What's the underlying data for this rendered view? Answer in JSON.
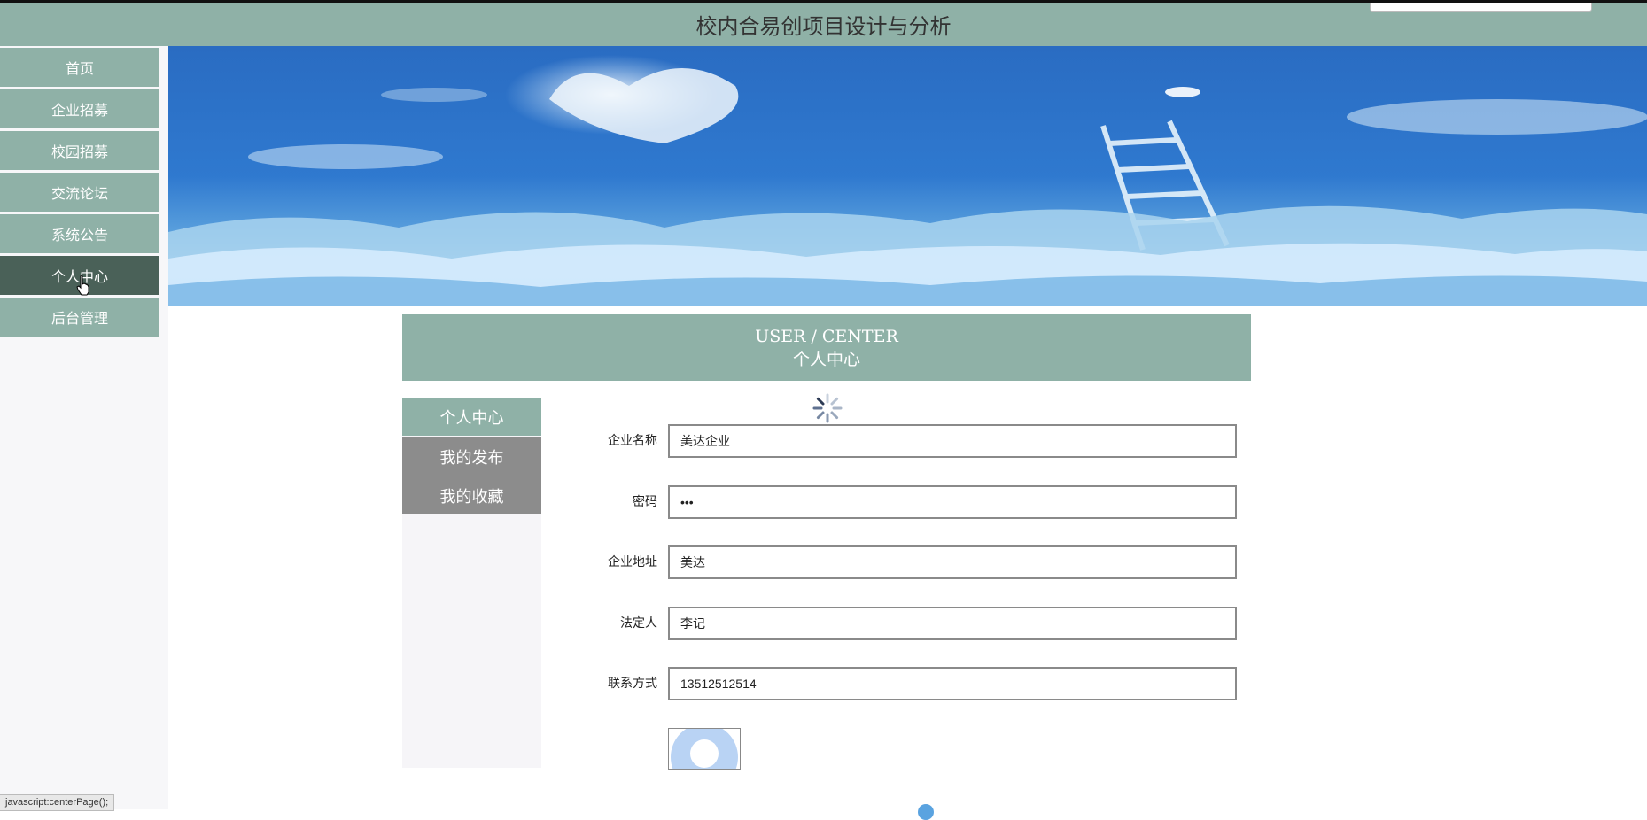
{
  "site": {
    "title": "校内合易创项目设计与分析"
  },
  "sidebar": {
    "items": [
      {
        "label": "首页"
      },
      {
        "label": "企业招募"
      },
      {
        "label": "校园招募"
      },
      {
        "label": "交流论坛"
      },
      {
        "label": "系统公告"
      },
      {
        "label": "个人中心",
        "active": true
      },
      {
        "label": "后台管理"
      }
    ]
  },
  "section": {
    "title_en": "USER / CENTER",
    "title_cn": "个人中心"
  },
  "subnav": {
    "items": [
      {
        "label": "个人中心",
        "active": true
      },
      {
        "label": "我的发布"
      },
      {
        "label": "我的收藏"
      }
    ]
  },
  "form": {
    "fields": [
      {
        "label": "企业名称",
        "value": "美达企业"
      },
      {
        "label": "密码",
        "value": "•••"
      },
      {
        "label": "企业地址",
        "value": "美达"
      },
      {
        "label": "法定人",
        "value": "李记"
      },
      {
        "label": "联系方式",
        "value": "13512512514"
      }
    ]
  },
  "status_bar": {
    "url": "javascript:centerPage();"
  },
  "colors": {
    "primary": "#8fb1a7",
    "active_dark": "#4a6158",
    "inactive_gray": "#8c8c8c"
  }
}
